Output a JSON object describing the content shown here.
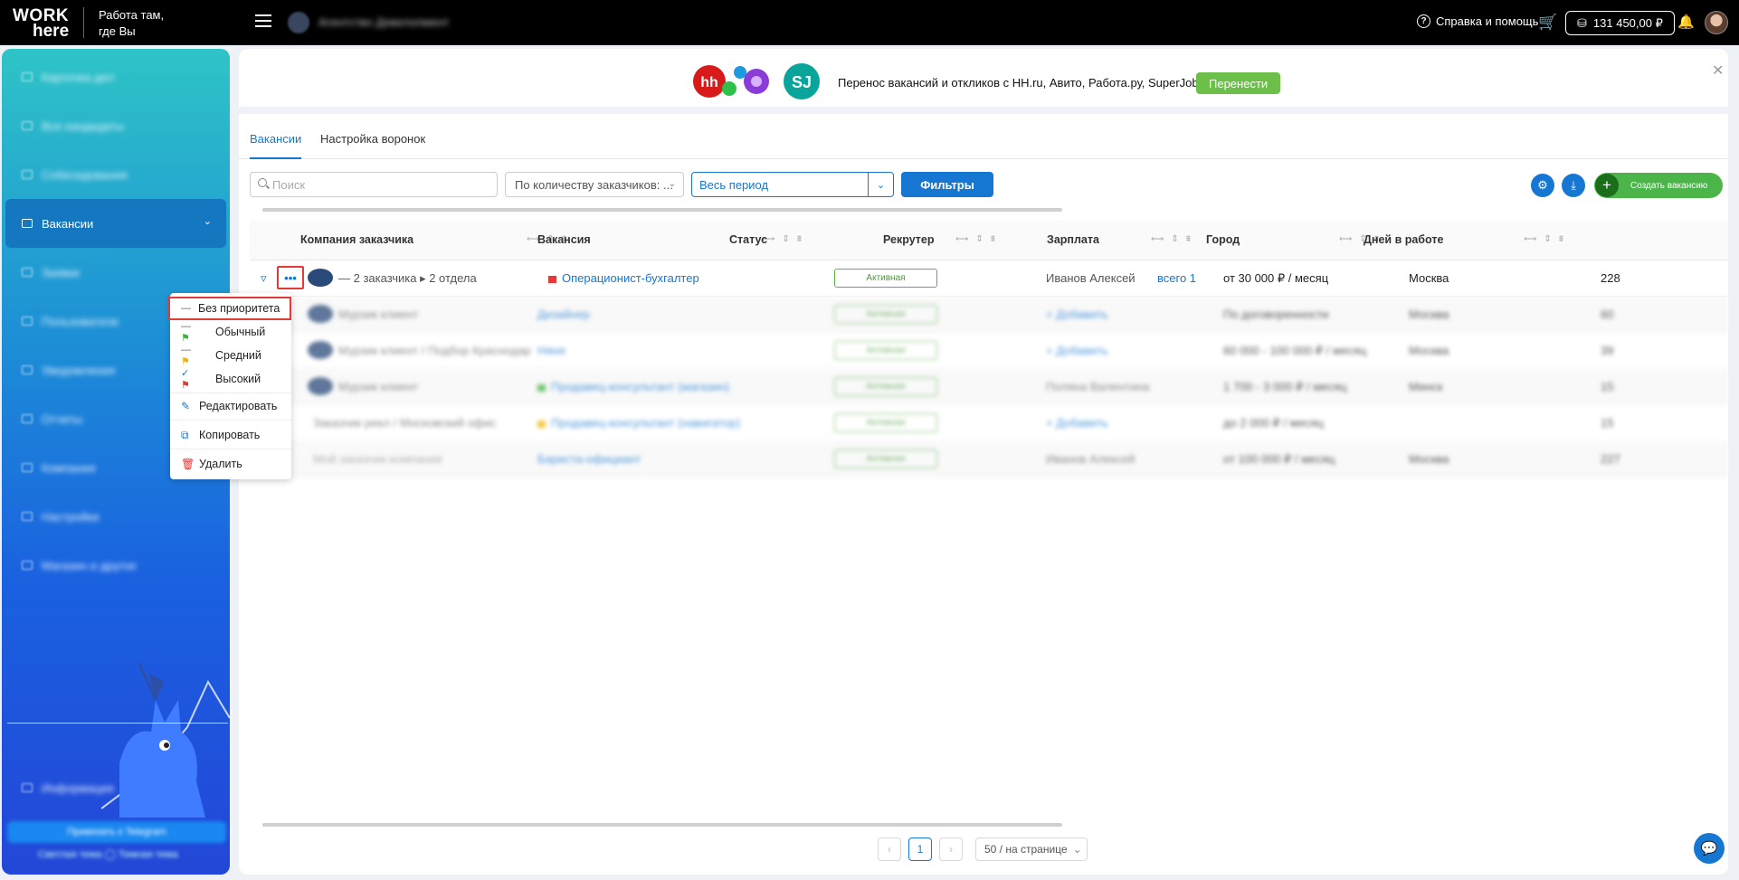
{
  "topbar": {
    "logo_line1": "WORK",
    "logo_line2": "here",
    "slogan_line1": "Работа там,",
    "slogan_line2": "где Вы",
    "help_label": "Справка и помощь",
    "balance": "131 450,00 ₽"
  },
  "sidebar": {
    "active_item": "Вакансии"
  },
  "banner": {
    "text": "Перенос вакансий и откликов с HH.ru, Авито, Работа.ру, SuperJob.ru",
    "button": "Перенести",
    "logos": [
      "hh",
      "SJ"
    ]
  },
  "tabs": [
    "Вакансии",
    "Настройка воронок"
  ],
  "filters": {
    "search_placeholder": "Поиск",
    "sort_select": "По количеству заказчиков: ...",
    "period_select": "Весь период",
    "filters_button": "Фильтры",
    "create_button": "Создать вакансию"
  },
  "table": {
    "columns": [
      "Компания заказчика",
      "Вакансия",
      "Статус",
      "Рекрутер",
      "Зарплата",
      "Город",
      "Дней в работе"
    ],
    "row1": {
      "company": "— 2 заказчика ▸ 2 отдела",
      "vacancy": "Операционист-бухгалтер",
      "status": "Активная",
      "recruiter": "Иванов Алексей",
      "recruiter_link": "всего 1",
      "salary": "от 30 000 ₽ / месяц",
      "city": "Москва",
      "days": "228"
    },
    "blurred_rows": [
      {
        "company": "Мурзик клиент",
        "vacancy": "Дизайнер",
        "status": "Активная",
        "recruiter": "+ Добавить",
        "salary": "По договоренности",
        "city": "Москва",
        "days": "60"
      },
      {
        "company": "Мурзик клиент / Подбор Краснодар",
        "vacancy": "Няня",
        "status": "Активная",
        "recruiter": "+ Добавить",
        "salary": "60 000 - 100 000 ₽ / месяц",
        "city": "Москва",
        "days": "39"
      },
      {
        "company": "Мурзик клиент",
        "vacancy": "Продавец-консультант (магазин)",
        "status": "Активная",
        "recruiter": "Поляна Валентина",
        "salary": "1 700 - 3 000 ₽ / месяц",
        "city": "Минск",
        "days": "15"
      },
      {
        "company": "Заказчик рекл / Московский офис",
        "vacancy": "Продавец-консультант (навигатор)",
        "status": "Активная",
        "recruiter": "+ Добавить",
        "salary": "до 2 000 ₽ / месяц",
        "city": "",
        "days": "15"
      },
      {
        "company": "Мой заказчик-компания",
        "vacancy": "Бариста-официант",
        "status": "Активная",
        "recruiter": "Иванов Алексей",
        "salary": "от 100 000 ₽ / месяц",
        "city": "Москва",
        "days": "227"
      }
    ]
  },
  "priority_menu": {
    "items": [
      "Без приоритета",
      "Обычный",
      "Средний",
      "Высокий"
    ],
    "actions": [
      "Редактировать",
      "Копировать",
      "Удалить"
    ]
  },
  "pagination": {
    "current_page": "1",
    "page_size": "50 / на странице"
  },
  "colors": {
    "accent": "#1677d2",
    "success": "#4bb54a",
    "danger": "#e53935"
  }
}
